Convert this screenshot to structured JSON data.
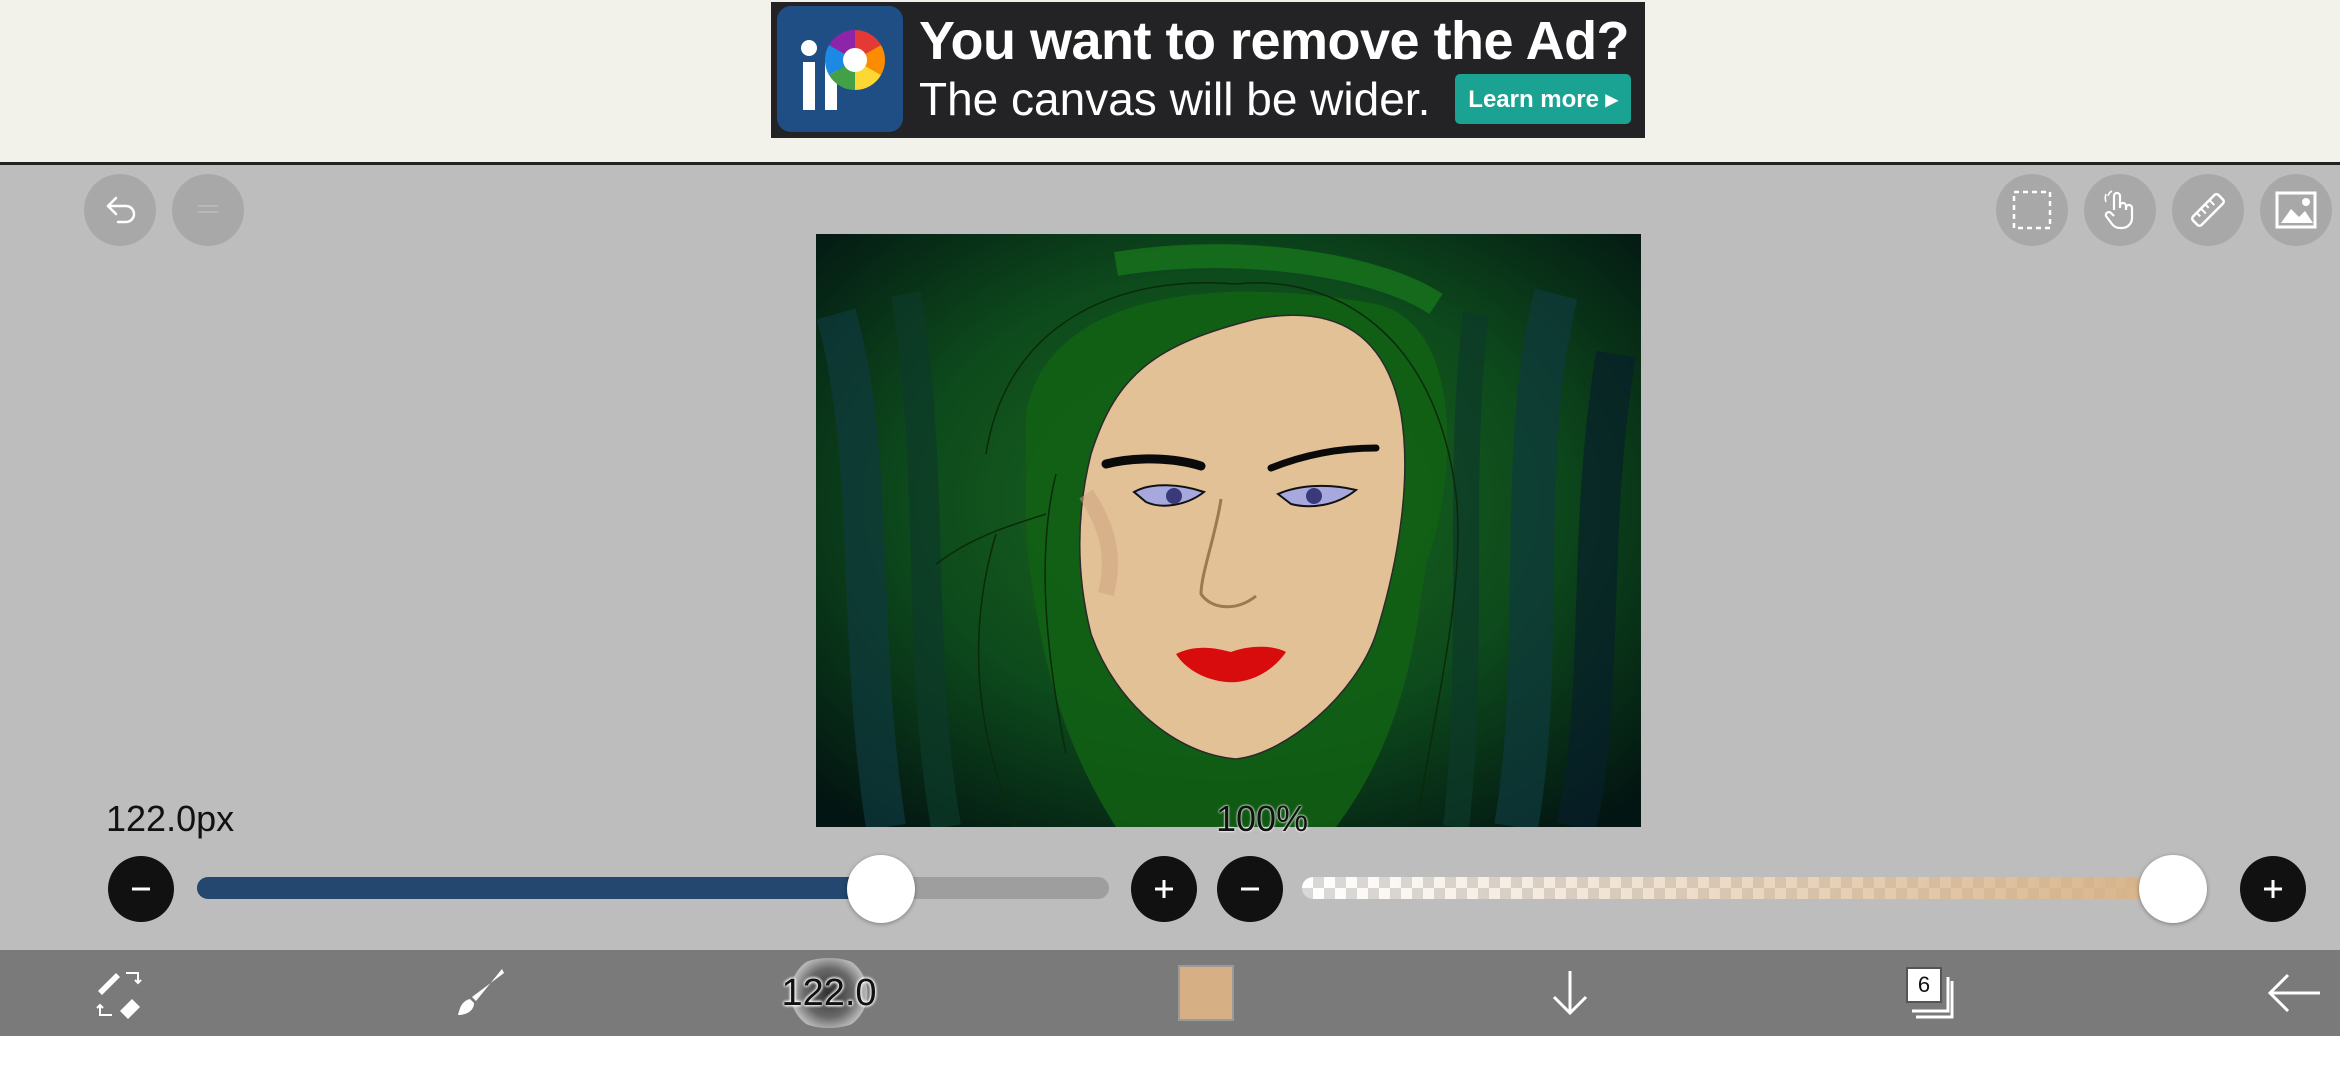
{
  "ad": {
    "title": "You want to remove the Ad?",
    "subtitle": "The canvas will be wider.",
    "cta_label": "Learn more ▸",
    "logo_text": "iP"
  },
  "toolbar_top": {
    "left_icons": [
      "undo-icon",
      "redo-icon"
    ],
    "right_icons": [
      "selection-icon",
      "hand-gesture-icon",
      "ruler-icon",
      "gallery-icon"
    ]
  },
  "canvas": {
    "description_colors": {
      "hair": "#0f5512",
      "skin": "#e2c095",
      "lips": "#d80c0c",
      "eyes": "#9fa2d6",
      "background": "#0b2a1e"
    }
  },
  "brush": {
    "size_label": "122.0px",
    "size_badge": "122.0",
    "size_fraction": 0.75
  },
  "zoom": {
    "label": "100%"
  },
  "opacity": {
    "fraction": 0.97
  },
  "colors": {
    "accent": "#23476f",
    "current_color": "#d6b084",
    "ad_cta": "#1aa392"
  },
  "bottom_bar": {
    "tools": [
      "pen-eraser-swap-icon",
      "brush-icon",
      "brush-size-badge",
      "color-swatch",
      "download-icon",
      "layers-icon",
      "back-arrow-icon"
    ],
    "layers_count": "6"
  }
}
